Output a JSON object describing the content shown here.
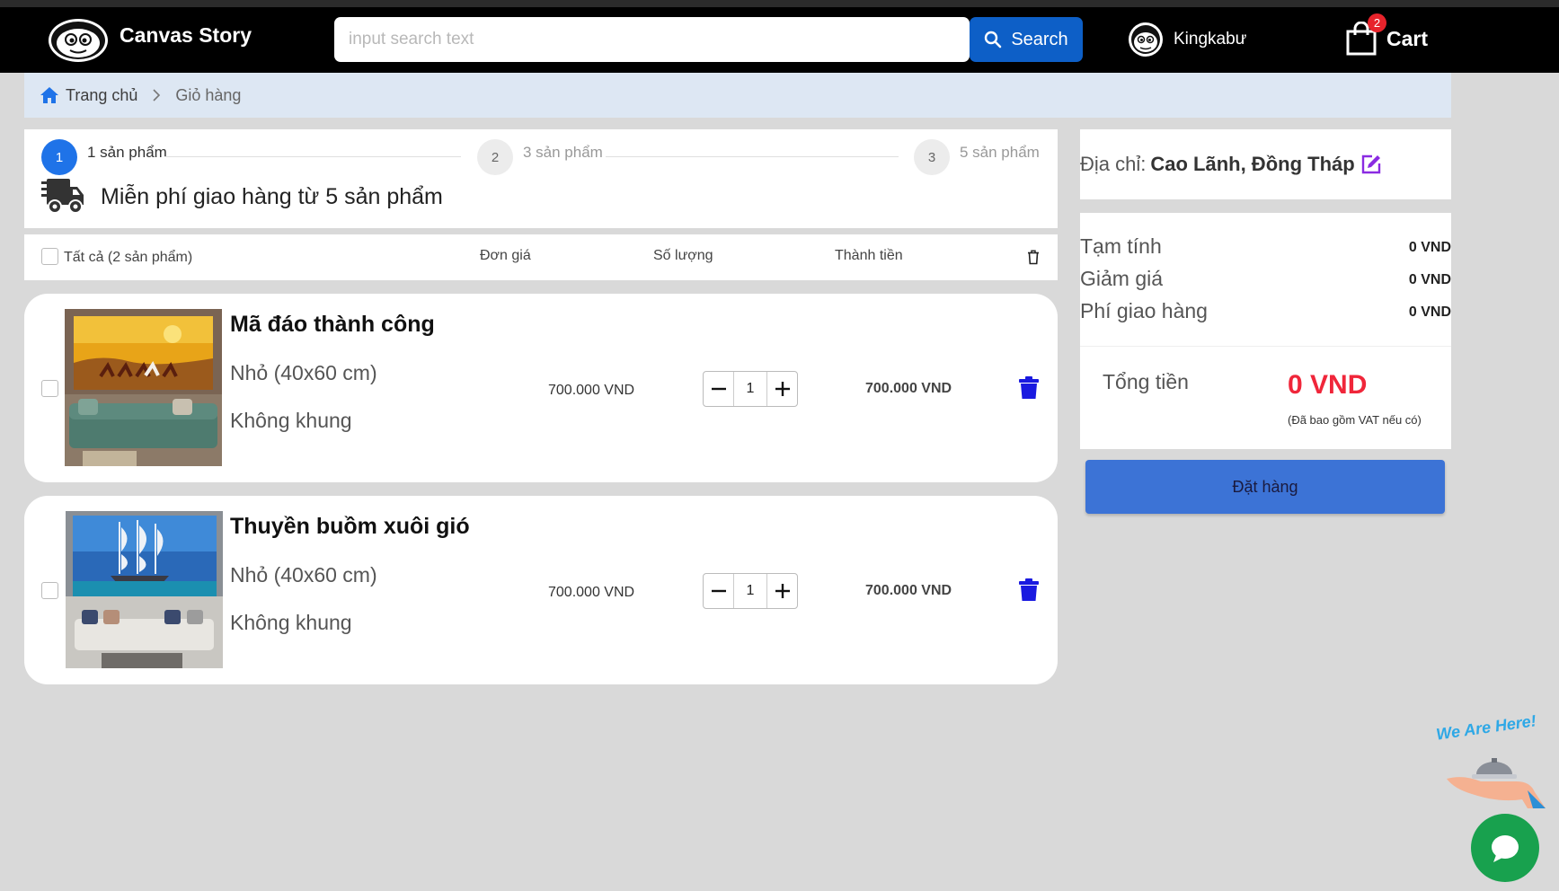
{
  "header": {
    "brand": "Canvas Story",
    "search_placeholder": "input search text",
    "search_label": "Search",
    "username": "Kingkabư",
    "cart_label": "Cart",
    "cart_count": "2"
  },
  "breadcrumb": {
    "home": "Trang chủ",
    "current": "Giỏ hàng"
  },
  "progress": {
    "steps": [
      {
        "num": "1",
        "label": "1 sản phẩm"
      },
      {
        "num": "2",
        "label": "3 sản phẩm"
      },
      {
        "num": "3",
        "label": "5 sản phẩm"
      }
    ],
    "active_step": 1,
    "shipping_text": "Miễn phí giao hàng từ 5 sản phẩm"
  },
  "table_header": {
    "select_all": "Tất cả (2 sản phẩm)",
    "unit_price": "Đơn giá",
    "quantity": "Số lượng",
    "total": "Thành tiền"
  },
  "items": [
    {
      "name": "Mã đáo thành công",
      "size": "Nhỏ (40x60 cm)",
      "frame": "Không khung",
      "price": "700.000 VND",
      "qty": "1",
      "total": "700.000 VND"
    },
    {
      "name": "Thuyền buồm xuôi gió",
      "size": "Nhỏ (40x60 cm)",
      "frame": "Không khung",
      "price": "700.000 VND",
      "qty": "1",
      "total": "700.000 VND"
    }
  ],
  "address": {
    "label": "Địa chỉ:",
    "value": "Cao Lãnh, Đồng Tháp"
  },
  "summary": {
    "subtotal_label": "Tạm tính",
    "subtotal": "0 VND",
    "discount_label": "Giảm giá",
    "discount": "0 VND",
    "shipping_label": "Phí giao hàng",
    "shipping": "0 VND",
    "total_label": "Tổng tiền",
    "total": "0 VND",
    "vat_note": "(Đã bao gồm VAT nếu có)"
  },
  "order_button": "Đặt hàng",
  "widget": {
    "tagline": "We Are Here!"
  },
  "colors": {
    "accent": "#1f73e8",
    "search_button": "#0d5fc7",
    "order_button": "#3c73d6",
    "total_red": "#f0263a",
    "trash_blue": "#1a1ae0"
  }
}
